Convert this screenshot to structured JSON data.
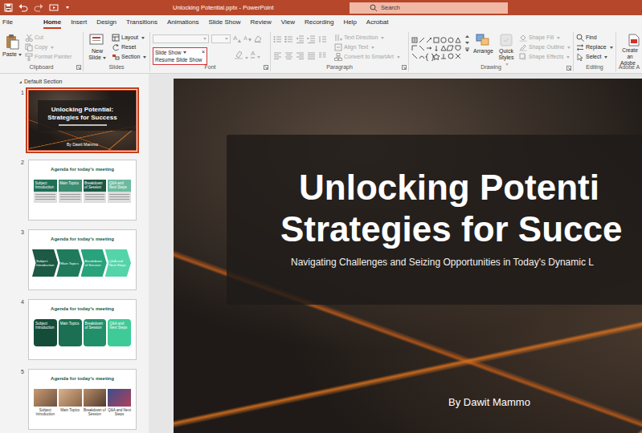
{
  "window": {
    "title": "Unlocking Potential.pptx - PowerPoint"
  },
  "search": {
    "placeholder": "Search"
  },
  "tabs": [
    {
      "label": "File",
      "selected": false
    },
    {
      "label": "Home",
      "selected": true
    },
    {
      "label": "Insert",
      "selected": false
    },
    {
      "label": "Design",
      "selected": false
    },
    {
      "label": "Transitions",
      "selected": false
    },
    {
      "label": "Animations",
      "selected": false
    },
    {
      "label": "Slide Show",
      "selected": false
    },
    {
      "label": "Review",
      "selected": false
    },
    {
      "label": "View",
      "selected": false
    },
    {
      "label": "Recording",
      "selected": false
    },
    {
      "label": "Help",
      "selected": false
    },
    {
      "label": "Acrobat",
      "selected": false
    }
  ],
  "ribbon": {
    "clipboard": {
      "label": "Clipboard",
      "paste": {
        "label": "Paste",
        "disabled": false
      },
      "items": [
        {
          "label": "Cut",
          "disabled": true,
          "dropdown": false
        },
        {
          "label": "Copy",
          "disabled": true,
          "dropdown": true
        },
        {
          "label": "Format Painter",
          "disabled": true,
          "dropdown": false
        }
      ]
    },
    "slides": {
      "label": "Slides",
      "new_slide": {
        "label": "New Slide",
        "disabled": false
      },
      "items": [
        {
          "label": "Layout",
          "disabled": false,
          "dropdown": true
        },
        {
          "label": "Reset",
          "disabled": false,
          "dropdown": false
        },
        {
          "label": "Section",
          "disabled": false,
          "dropdown": true
        }
      ]
    },
    "font": {
      "label": "Font",
      "disabled": true,
      "grow": "A",
      "shrink": "A",
      "color": "A"
    },
    "paragraph": {
      "label": "Paragraph",
      "disabled": true,
      "items": [
        {
          "label": "Text Direction",
          "disabled": true,
          "dropdown": true
        },
        {
          "label": "Align Text",
          "disabled": true,
          "dropdown": true
        },
        {
          "label": "Convert to SmartArt",
          "disabled": true,
          "dropdown": true
        }
      ]
    },
    "drawing": {
      "label": "Drawing",
      "arrange": {
        "label": "Arrange",
        "disabled": false
      },
      "quick_styles": {
        "label": "Quick Styles",
        "disabled": true
      },
      "items": [
        {
          "label": "Shape Fill",
          "disabled": true,
          "dropdown": true
        },
        {
          "label": "Shape Outline",
          "disabled": true,
          "dropdown": true
        },
        {
          "label": "Shape Effects",
          "disabled": true,
          "dropdown": true
        }
      ]
    },
    "editing": {
      "label": "Editing",
      "items": [
        {
          "label": "Find",
          "disabled": false,
          "dropdown": false
        },
        {
          "label": "Replace",
          "disabled": false,
          "dropdown": true
        },
        {
          "label": "Select",
          "disabled": false,
          "dropdown": true
        }
      ]
    },
    "adobe": {
      "label": "Adobe A",
      "button": [
        "Create an",
        "Adobe"
      ]
    }
  },
  "popup": {
    "title": "Slide Show",
    "close": "×",
    "items": [
      "Resume Slide Show"
    ]
  },
  "section": {
    "label": "Default Section",
    "expanded": true
  },
  "thumbnails": [
    {
      "number": "1",
      "selected": true,
      "kind": "title",
      "title_lines": [
        "Unlocking Potential:",
        "Strategies for Success"
      ],
      "author": "By Dawit Mammo"
    },
    {
      "number": "2",
      "selected": false,
      "kind": "boxes",
      "title": "Agenda for today's meeting",
      "items": [
        {
          "label": "Subject Introduction",
          "color": "#1f6f55"
        },
        {
          "label": "Main Topics",
          "color": "#3c8c72"
        },
        {
          "label": "Breakdown of Session",
          "color": "#1b5944"
        },
        {
          "label": "Q&A and Next Steps",
          "color": "#6dbb9f"
        }
      ]
    },
    {
      "number": "3",
      "selected": false,
      "kind": "chevrons",
      "title": "Agenda for today's meeting",
      "items": [
        {
          "label": "Subject Introduction",
          "color": "#1c5a45"
        },
        {
          "label": "Main Topics",
          "color": "#1f7b5c"
        },
        {
          "label": "Breakdown of Session",
          "color": "#29a37b"
        },
        {
          "label": "Q&A and Next Steps",
          "color": "#55d4aa"
        }
      ]
    },
    {
      "number": "4",
      "selected": false,
      "kind": "rounded",
      "title": "Agenda for today's meeting",
      "items": [
        {
          "label": "Subject Introduction",
          "color": "#134d3a"
        },
        {
          "label": "Main Topics",
          "color": "#1b6f52"
        },
        {
          "label": "Breakdown of Session",
          "color": "#21906a"
        },
        {
          "label": "Q&A and Next Steps",
          "color": "#3ecb98"
        }
      ]
    },
    {
      "number": "5",
      "selected": false,
      "kind": "photos",
      "title": "Agenda for today's meeting",
      "items": [
        {
          "label": "Subject Introduction"
        },
        {
          "label": "Main Topics"
        },
        {
          "label": "Breakdown of Session"
        },
        {
          "label": "Q&A and Next Steps"
        }
      ]
    }
  ],
  "slide": {
    "title_lines": [
      "Unlocking Potenti",
      "Strategies for Succe"
    ],
    "subtitle": "Navigating Challenges and Seizing Opportunities in Today's Dynamic L",
    "author": "By Dawit Mammo"
  }
}
